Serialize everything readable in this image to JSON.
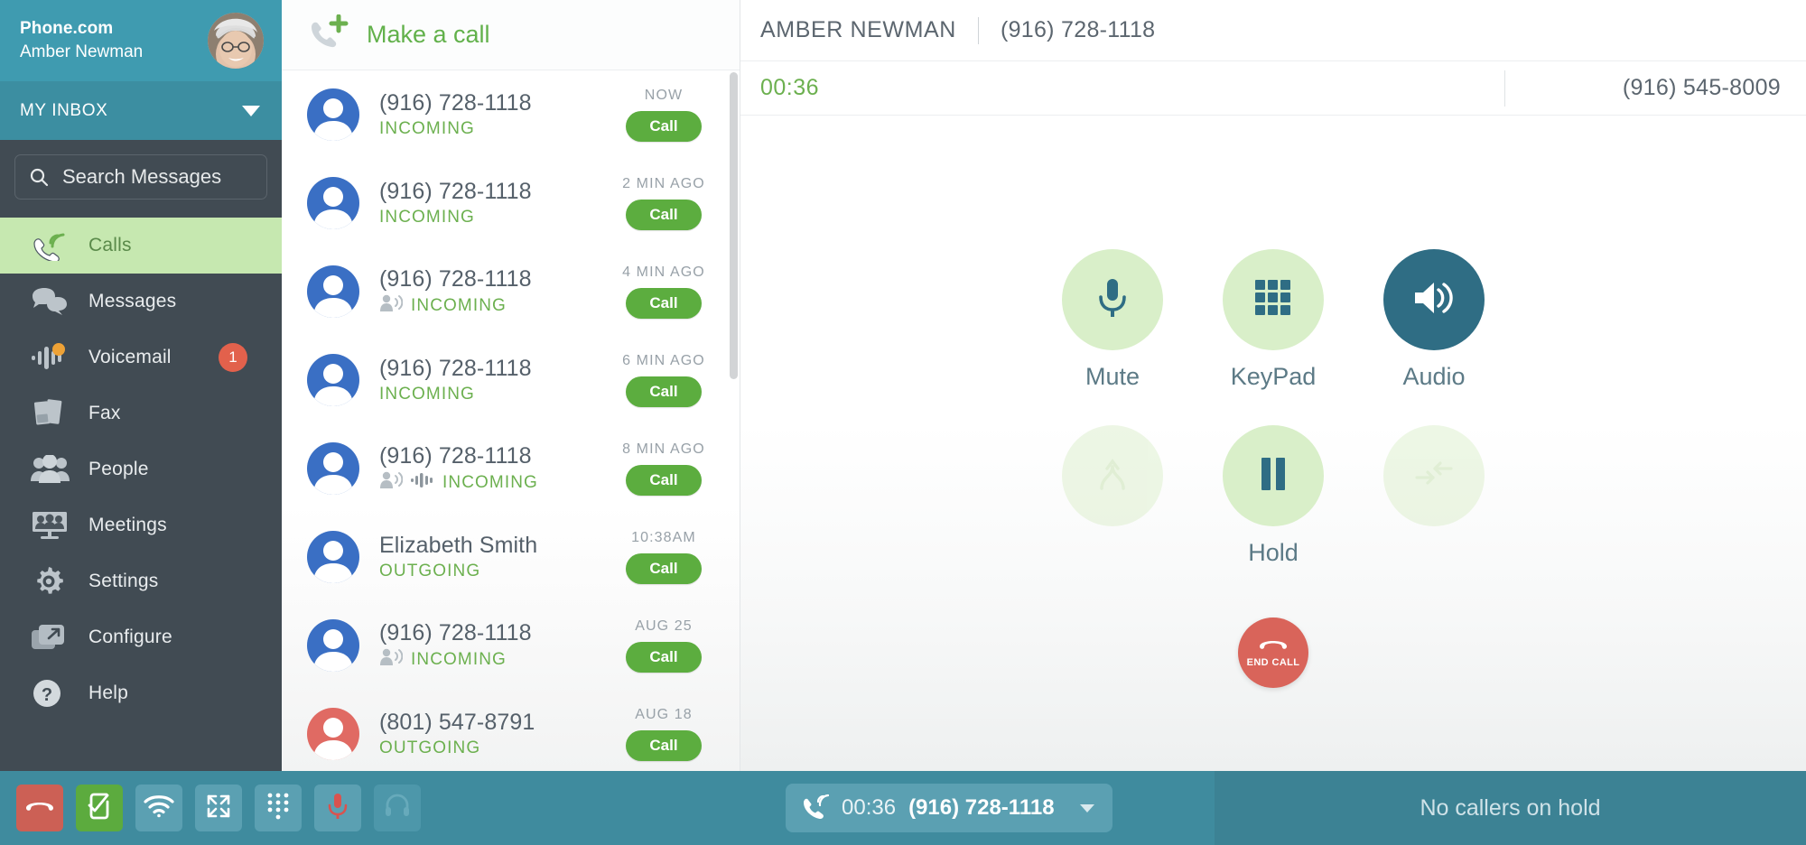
{
  "sidebar": {
    "brand": "Phone.com",
    "user_name": "Amber Newman",
    "avatar_icon": "user-photo-avatar",
    "inbox": {
      "label": "MY INBOX",
      "caret_icon": "chevron-down-icon"
    },
    "search": {
      "placeholder": "Search Messages",
      "value": "",
      "icon": "search-icon"
    },
    "items": [
      {
        "label": "Calls",
        "icon": "phone-incoming-icon",
        "active": true,
        "badge": null
      },
      {
        "label": "Messages",
        "icon": "chat-bubbles-icon",
        "active": false,
        "badge": null
      },
      {
        "label": "Voicemail",
        "icon": "waveform-icon",
        "active": false,
        "badge": "1"
      },
      {
        "label": "Fax",
        "icon": "fax-pages-icon",
        "active": false,
        "badge": null
      },
      {
        "label": "People",
        "icon": "people-group-icon",
        "active": false,
        "badge": null
      },
      {
        "label": "Meetings",
        "icon": "monitor-people-icon",
        "active": false,
        "badge": null
      },
      {
        "label": "Settings",
        "icon": "gear-icon",
        "active": false,
        "badge": null
      },
      {
        "label": "Configure",
        "icon": "window-arrow-icon",
        "active": false,
        "badge": null
      },
      {
        "label": "Help",
        "icon": "question-circle-icon",
        "active": false,
        "badge": null
      }
    ]
  },
  "call_list": {
    "make_a_call": {
      "label": "Make a call",
      "icon": "phone-plus-icon"
    },
    "call_button_label": "Call",
    "rows": [
      {
        "title": "(916) 728-1118",
        "direction": "INCOMING",
        "time": "NOW",
        "avatar_color": "blue",
        "badges": []
      },
      {
        "title": "(916) 728-1118",
        "direction": "INCOMING",
        "time": "2 MIN AGO",
        "avatar_color": "blue",
        "badges": []
      },
      {
        "title": "(916) 728-1118",
        "direction": "INCOMING",
        "time": "4 MIN AGO",
        "avatar_color": "blue",
        "badges": [
          "voice-announce-icon"
        ]
      },
      {
        "title": "(916) 728-1118",
        "direction": "INCOMING",
        "time": "6 MIN AGO",
        "avatar_color": "blue",
        "badges": []
      },
      {
        "title": "(916) 728-1118",
        "direction": "INCOMING",
        "time": "8 MIN AGO",
        "avatar_color": "blue",
        "badges": [
          "voice-announce-icon",
          "waveform-icon"
        ]
      },
      {
        "title": "Elizabeth Smith",
        "direction": "OUTGOING",
        "time": "10:38AM",
        "avatar_color": "blue",
        "badges": []
      },
      {
        "title": "(916) 728-1118",
        "direction": "INCOMING",
        "time": "AUG 25",
        "avatar_color": "blue",
        "badges": [
          "voice-announce-icon"
        ]
      },
      {
        "title": "(801) 547-8791",
        "direction": "OUTGOING",
        "time": "AUG 18",
        "avatar_color": "red",
        "badges": []
      }
    ]
  },
  "call_panel": {
    "contact_name": "AMBER NEWMAN",
    "contact_number": "(916) 728-1118",
    "timer": "00:36",
    "own_number": "(916) 545-8009",
    "controls_row1": [
      {
        "label": "Mute",
        "icon": "microphone-icon",
        "state": "normal"
      },
      {
        "label": "KeyPad",
        "icon": "keypad-grid-icon",
        "state": "normal"
      },
      {
        "label": "Audio",
        "icon": "speaker-icon",
        "state": "selected"
      }
    ],
    "controls_row2": [
      {
        "label": "",
        "icon": "merge-call-icon",
        "state": "disabled"
      },
      {
        "label": "Hold",
        "icon": "pause-icon",
        "state": "normal"
      },
      {
        "label": "",
        "icon": "transfer-call-icon",
        "state": "disabled"
      }
    ],
    "end_call": {
      "label": "END CALL",
      "icon": "phone-hangup-icon"
    }
  },
  "bottom_bar": {
    "tools": [
      {
        "icon": "phone-hangup-icon",
        "style": "red"
      },
      {
        "icon": "phone-check-icon",
        "style": "green"
      },
      {
        "icon": "wifi-icon",
        "style": "blue"
      },
      {
        "icon": "expand-icon",
        "style": "blue"
      },
      {
        "icon": "dialpad-dots-icon",
        "style": "blue"
      },
      {
        "icon": "microphone-red-icon",
        "style": "blue"
      },
      {
        "icon": "headset-icon",
        "style": "dim"
      }
    ],
    "active_call": {
      "timer": "00:36",
      "number": "(916) 728-1118",
      "icon": "phone-active-icon",
      "caret_icon": "chevron-down-icon"
    },
    "hold_status": "No callers on hold"
  },
  "colors": {
    "teal_header": "#3f9bb0",
    "teal_inbox": "#3c8ea1",
    "sidebar_dark": "#414b53",
    "active_green_bg": "#c6e8b0",
    "green_accent": "#62b14b",
    "call_button": "#5cad3f",
    "audio_selected": "#2f6d84",
    "end_call_red": "#d9645a",
    "badge_red": "#e2614c",
    "bottombar_teal": "#3f8b9e"
  }
}
